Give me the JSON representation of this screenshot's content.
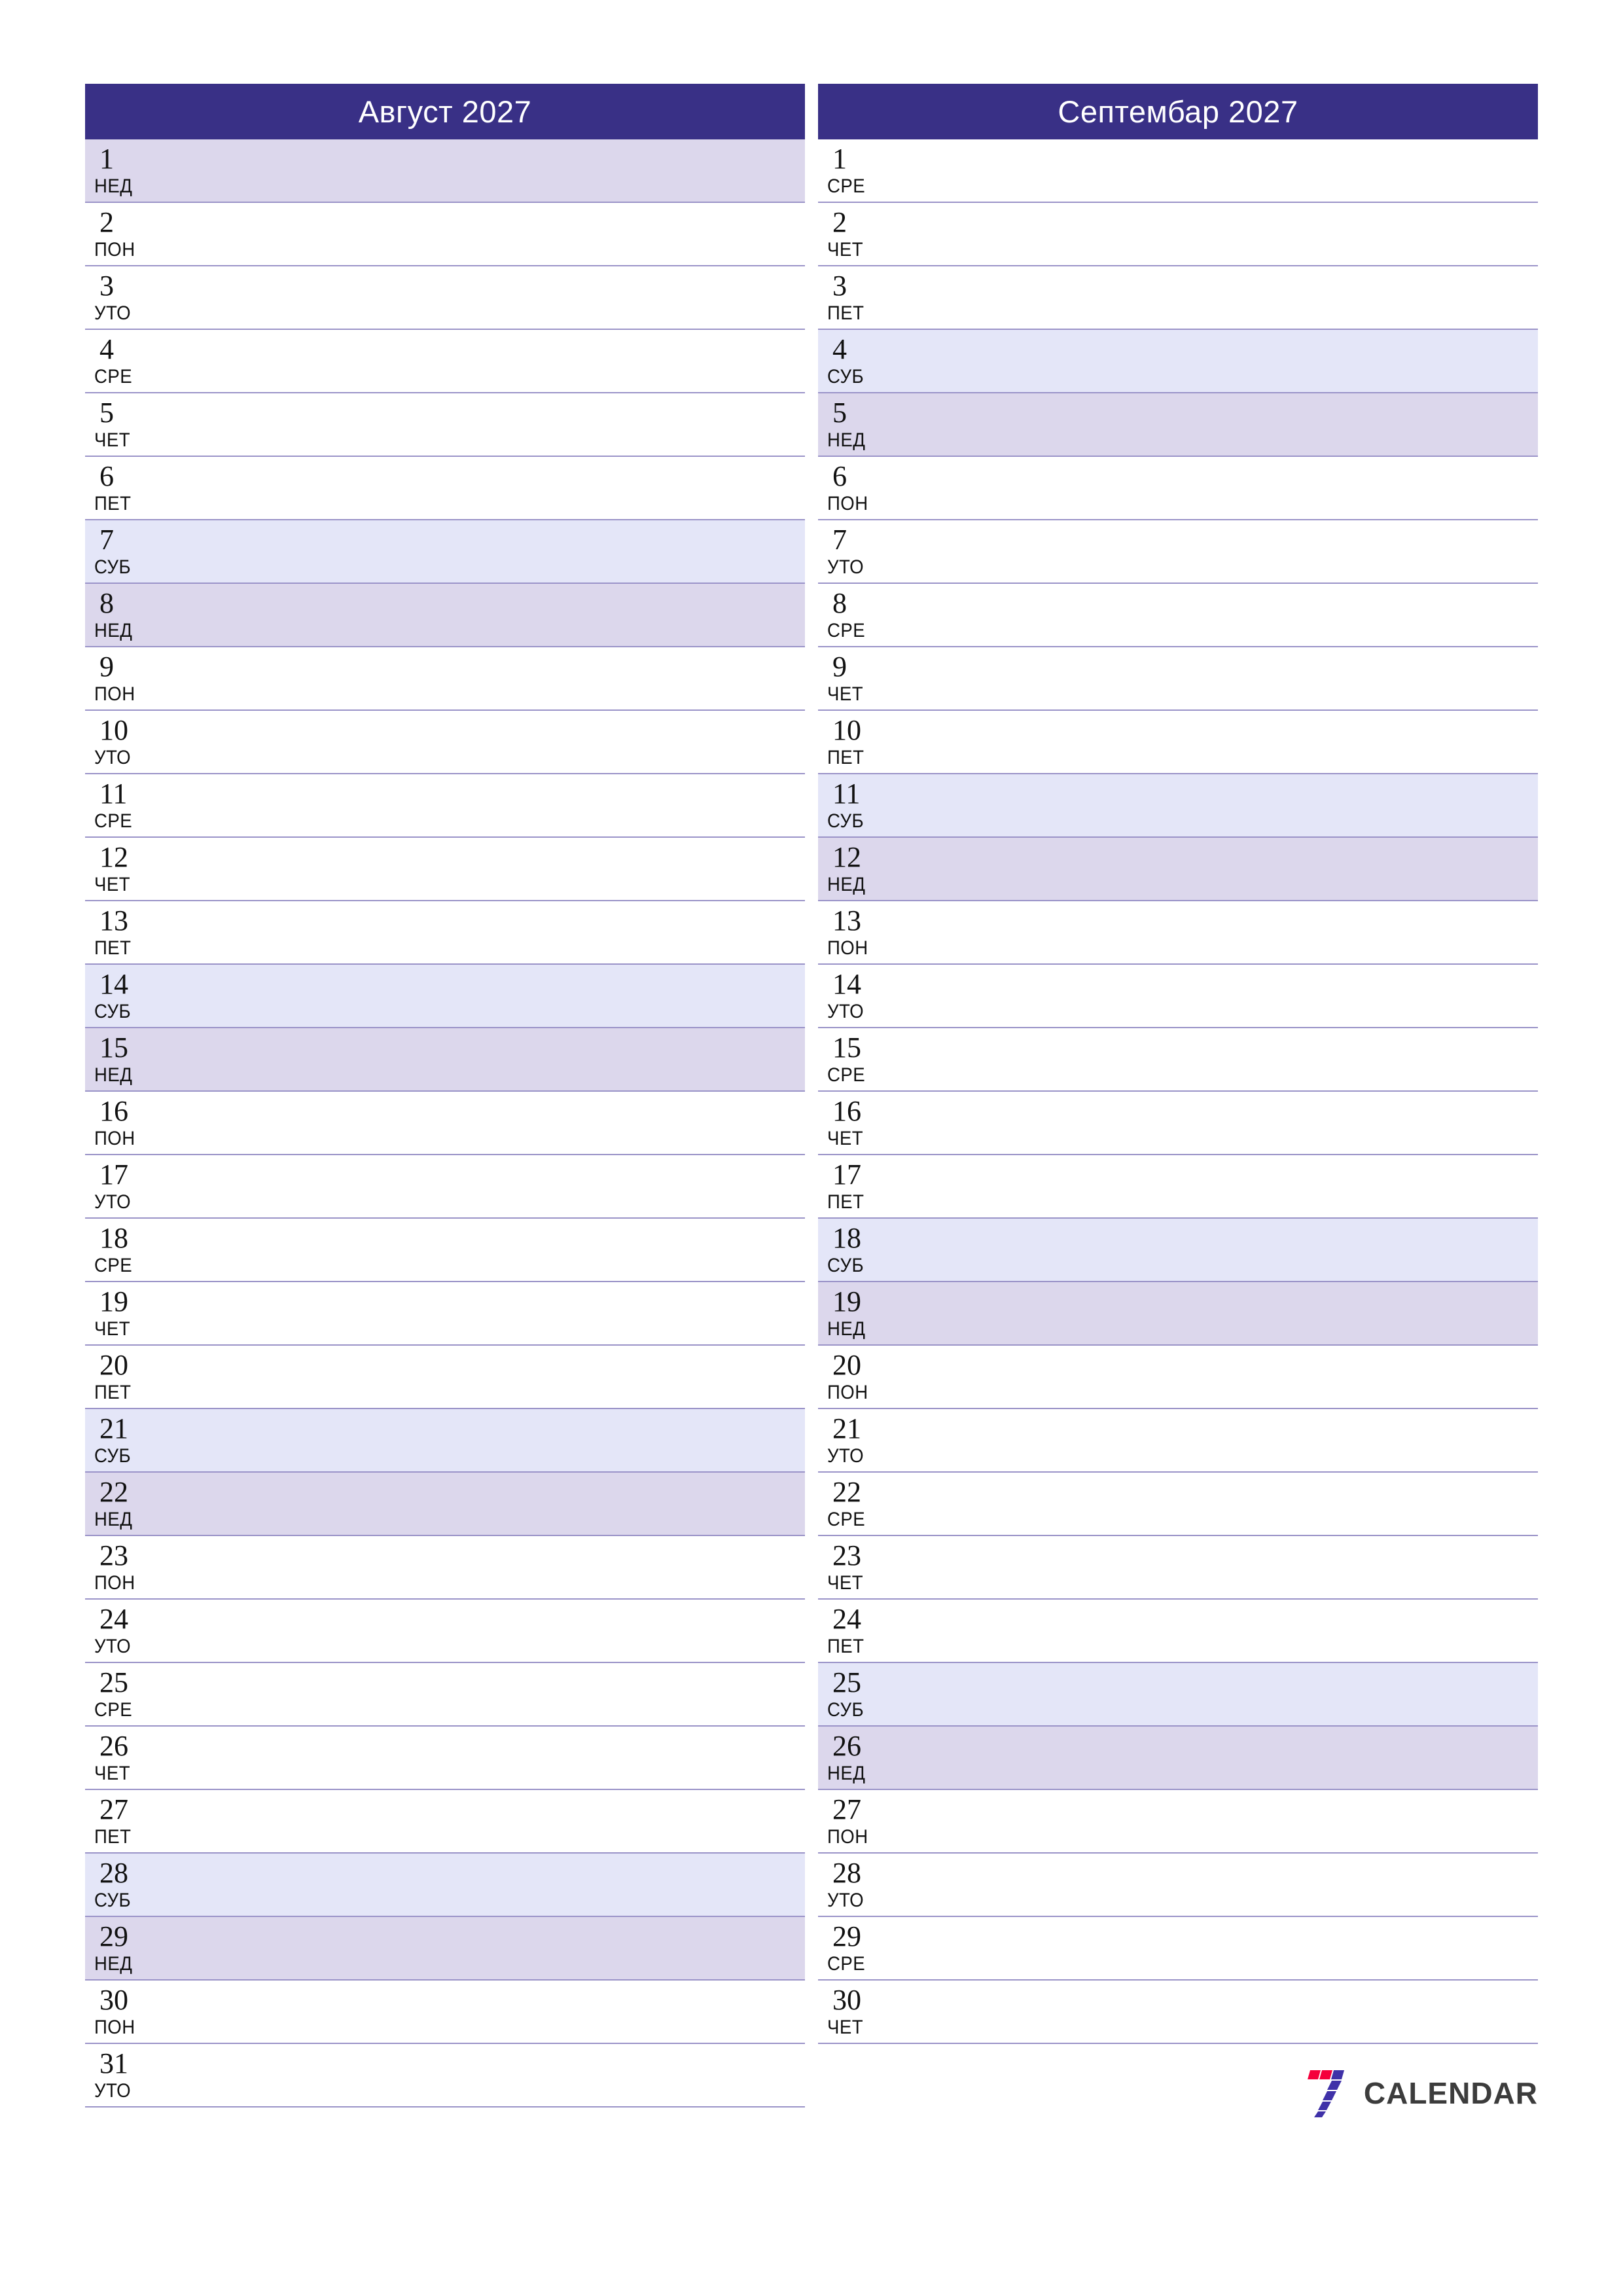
{
  "theme": {
    "header_bg": "#393086",
    "header_text": "#ffffff",
    "saturday_bg": "#e4e6f8",
    "sunday_bg": "#dcd7ec",
    "row_line": "#9a93c8",
    "page_bg": "#ffffff",
    "logo_red": "#f5003c",
    "logo_purple": "#3f31a8",
    "logo_text_color": "#3c3c3c"
  },
  "brand": {
    "name": "CALENDAR",
    "mark": "seven-blocks-logo"
  },
  "months": [
    {
      "title": "Август 2027",
      "name": "Август",
      "year": "2027",
      "days": [
        {
          "num": "1",
          "abbr": "НЕД",
          "type": "sun"
        },
        {
          "num": "2",
          "abbr": "ПОН",
          "type": "weekday"
        },
        {
          "num": "3",
          "abbr": "УТО",
          "type": "weekday"
        },
        {
          "num": "4",
          "abbr": "СРЕ",
          "type": "weekday"
        },
        {
          "num": "5",
          "abbr": "ЧЕТ",
          "type": "weekday"
        },
        {
          "num": "6",
          "abbr": "ПЕТ",
          "type": "weekday"
        },
        {
          "num": "7",
          "abbr": "СУБ",
          "type": "sat"
        },
        {
          "num": "8",
          "abbr": "НЕД",
          "type": "sun"
        },
        {
          "num": "9",
          "abbr": "ПОН",
          "type": "weekday"
        },
        {
          "num": "10",
          "abbr": "УТО",
          "type": "weekday"
        },
        {
          "num": "11",
          "abbr": "СРЕ",
          "type": "weekday"
        },
        {
          "num": "12",
          "abbr": "ЧЕТ",
          "type": "weekday"
        },
        {
          "num": "13",
          "abbr": "ПЕТ",
          "type": "weekday"
        },
        {
          "num": "14",
          "abbr": "СУБ",
          "type": "sat"
        },
        {
          "num": "15",
          "abbr": "НЕД",
          "type": "sun"
        },
        {
          "num": "16",
          "abbr": "ПОН",
          "type": "weekday"
        },
        {
          "num": "17",
          "abbr": "УТО",
          "type": "weekday"
        },
        {
          "num": "18",
          "abbr": "СРЕ",
          "type": "weekday"
        },
        {
          "num": "19",
          "abbr": "ЧЕТ",
          "type": "weekday"
        },
        {
          "num": "20",
          "abbr": "ПЕТ",
          "type": "weekday"
        },
        {
          "num": "21",
          "abbr": "СУБ",
          "type": "sat"
        },
        {
          "num": "22",
          "abbr": "НЕД",
          "type": "sun"
        },
        {
          "num": "23",
          "abbr": "ПОН",
          "type": "weekday"
        },
        {
          "num": "24",
          "abbr": "УТО",
          "type": "weekday"
        },
        {
          "num": "25",
          "abbr": "СРЕ",
          "type": "weekday"
        },
        {
          "num": "26",
          "abbr": "ЧЕТ",
          "type": "weekday"
        },
        {
          "num": "27",
          "abbr": "ПЕТ",
          "type": "weekday"
        },
        {
          "num": "28",
          "abbr": "СУБ",
          "type": "sat"
        },
        {
          "num": "29",
          "abbr": "НЕД",
          "type": "sun"
        },
        {
          "num": "30",
          "abbr": "ПОН",
          "type": "weekday"
        },
        {
          "num": "31",
          "abbr": "УТО",
          "type": "weekday"
        }
      ]
    },
    {
      "title": "Септембар 2027",
      "name": "Септембар",
      "year": "2027",
      "days": [
        {
          "num": "1",
          "abbr": "СРЕ",
          "type": "weekday"
        },
        {
          "num": "2",
          "abbr": "ЧЕТ",
          "type": "weekday"
        },
        {
          "num": "3",
          "abbr": "ПЕТ",
          "type": "weekday"
        },
        {
          "num": "4",
          "abbr": "СУБ",
          "type": "sat"
        },
        {
          "num": "5",
          "abbr": "НЕД",
          "type": "sun"
        },
        {
          "num": "6",
          "abbr": "ПОН",
          "type": "weekday"
        },
        {
          "num": "7",
          "abbr": "УТО",
          "type": "weekday"
        },
        {
          "num": "8",
          "abbr": "СРЕ",
          "type": "weekday"
        },
        {
          "num": "9",
          "abbr": "ЧЕТ",
          "type": "weekday"
        },
        {
          "num": "10",
          "abbr": "ПЕТ",
          "type": "weekday"
        },
        {
          "num": "11",
          "abbr": "СУБ",
          "type": "sat"
        },
        {
          "num": "12",
          "abbr": "НЕД",
          "type": "sun"
        },
        {
          "num": "13",
          "abbr": "ПОН",
          "type": "weekday"
        },
        {
          "num": "14",
          "abbr": "УТО",
          "type": "weekday"
        },
        {
          "num": "15",
          "abbr": "СРЕ",
          "type": "weekday"
        },
        {
          "num": "16",
          "abbr": "ЧЕТ",
          "type": "weekday"
        },
        {
          "num": "17",
          "abbr": "ПЕТ",
          "type": "weekday"
        },
        {
          "num": "18",
          "abbr": "СУБ",
          "type": "sat"
        },
        {
          "num": "19",
          "abbr": "НЕД",
          "type": "sun"
        },
        {
          "num": "20",
          "abbr": "ПОН",
          "type": "weekday"
        },
        {
          "num": "21",
          "abbr": "УТО",
          "type": "weekday"
        },
        {
          "num": "22",
          "abbr": "СРЕ",
          "type": "weekday"
        },
        {
          "num": "23",
          "abbr": "ЧЕТ",
          "type": "weekday"
        },
        {
          "num": "24",
          "abbr": "ПЕТ",
          "type": "weekday"
        },
        {
          "num": "25",
          "abbr": "СУБ",
          "type": "sat"
        },
        {
          "num": "26",
          "abbr": "НЕД",
          "type": "sun"
        },
        {
          "num": "27",
          "abbr": "ПОН",
          "type": "weekday"
        },
        {
          "num": "28",
          "abbr": "УТО",
          "type": "weekday"
        },
        {
          "num": "29",
          "abbr": "СРЕ",
          "type": "weekday"
        },
        {
          "num": "30",
          "abbr": "ЧЕТ",
          "type": "weekday"
        }
      ]
    }
  ]
}
